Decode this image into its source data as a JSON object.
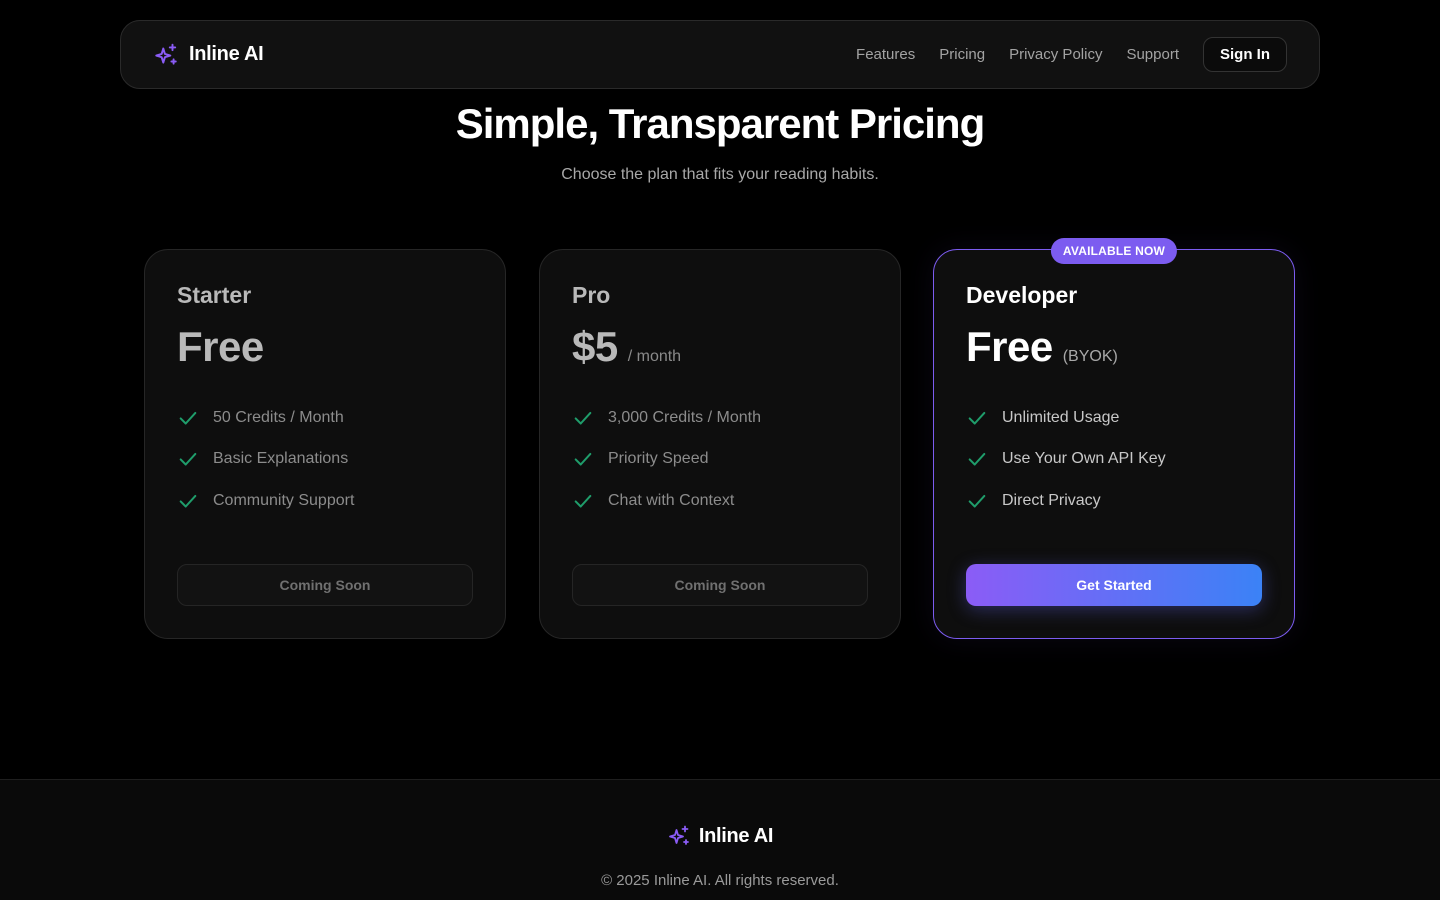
{
  "brand": {
    "name": "Inline AI",
    "icon": "sparkles-icon",
    "accent": "#7c5cf0"
  },
  "nav": {
    "links": [
      "Features",
      "Pricing",
      "Privacy Policy",
      "Support"
    ],
    "sign_in": "Sign In"
  },
  "hero": {
    "title": "Simple, Transparent Pricing",
    "subtitle": "Choose the plan that fits your reading habits."
  },
  "plans": [
    {
      "name": "Starter",
      "price": "Free",
      "suffix": "",
      "features": [
        "50 Credits / Month",
        "Basic Explanations",
        "Community Support"
      ],
      "cta": "Coming Soon"
    },
    {
      "name": "Pro",
      "price": "$5",
      "suffix": "/ month",
      "features": [
        "3,000 Credits / Month",
        "Priority Speed",
        "Chat with Context"
      ],
      "cta": "Coming Soon"
    },
    {
      "name": "Developer",
      "badge": "AVAILABLE NOW",
      "price": "Free",
      "suffix": "(BYOK)",
      "features": [
        "Unlimited Usage",
        "Use Your Own API Key",
        "Direct Privacy"
      ],
      "cta": "Get Started"
    }
  ],
  "colors": {
    "check": "#1f9d6b",
    "gradient_start": "#8b5cf6",
    "gradient_end": "#3b82f6"
  },
  "footer": {
    "brand": "Inline AI",
    "copyright": "© 2025 Inline AI. All rights reserved."
  }
}
